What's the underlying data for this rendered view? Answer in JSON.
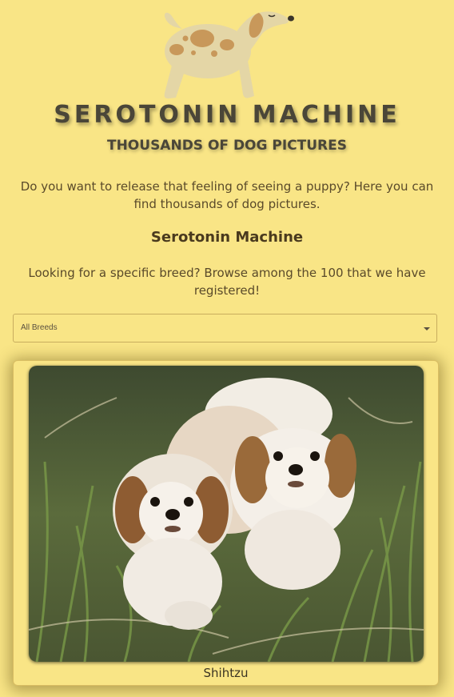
{
  "header": {
    "title": "SEROTONIN MACHINE",
    "subtitle": "THOUSANDS OF DOG PICTURES"
  },
  "intro": {
    "text": "Do you want to release that feeling of seeing a puppy? Here you can find thousands of dog pictures."
  },
  "section": {
    "heading": "Serotonin Machine",
    "breed_text": "Looking for a specific breed? Browse among the 100 that we have registered!"
  },
  "breed_select": {
    "value": "All Breeds"
  },
  "card": {
    "caption": "Shihtzu"
  },
  "colors": {
    "background": "#f9e586",
    "title": "#4a4638",
    "dog_body": "#e4d6a6",
    "dog_spots": "#c8985a"
  }
}
